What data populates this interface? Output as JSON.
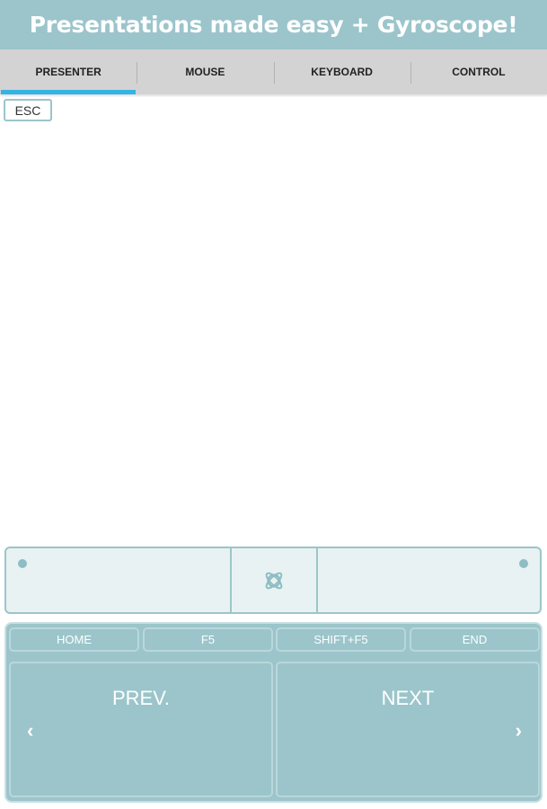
{
  "app": {
    "title": "Presentations made easy + Gyroscope!"
  },
  "tabs": [
    {
      "label": "PRESENTER",
      "active": true
    },
    {
      "label": "MOUSE",
      "active": false
    },
    {
      "label": "KEYBOARD",
      "active": false
    },
    {
      "label": "CONTROL",
      "active": false
    }
  ],
  "esc_label": "ESC",
  "touchpad": {
    "center_icon": "gyroscope-icon",
    "left_indicator": "dot-indicator",
    "right_indicator": "dot-indicator"
  },
  "keys": {
    "home": "HOME",
    "f5": "F5",
    "shift_f5": "SHIFT+F5",
    "end": "END"
  },
  "nav": {
    "prev_label": "PREV.",
    "next_label": "NEXT",
    "prev_chevron": "‹",
    "next_chevron": "›"
  },
  "colors": {
    "accent": "#9bc5cb",
    "tab_indicator": "#35b3e4",
    "touchpad_bg": "#e8f2f3"
  }
}
